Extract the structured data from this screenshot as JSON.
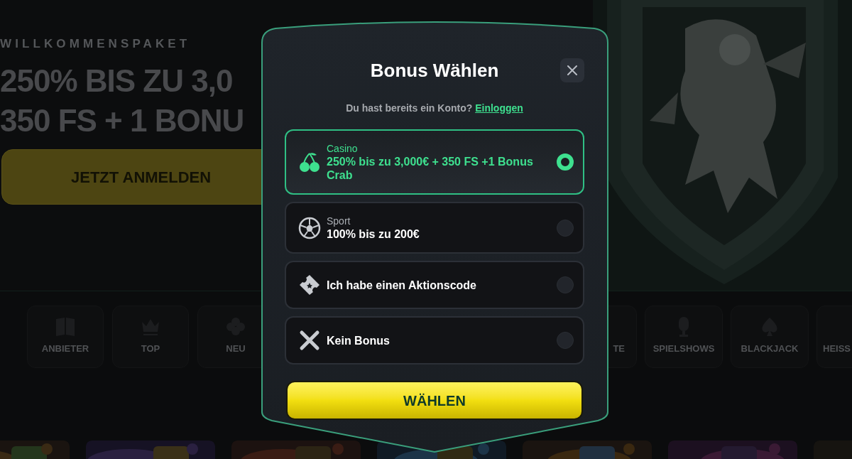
{
  "hero": {
    "eyebrow": "WILLKOMMENSPAKET",
    "headline_lines": [
      "250% BIS ZU 3,0",
      "350 FS + 1 BONU"
    ],
    "cta": "JETZT ANMELDEN"
  },
  "categories_left": [
    {
      "kind": "book",
      "label": "ANBIETER"
    },
    {
      "kind": "crown",
      "label": "TOP"
    },
    {
      "kind": "clover",
      "label": "NEU"
    }
  ],
  "categories_right": [
    {
      "kind": "hidden",
      "label": "TE"
    },
    {
      "kind": "microphone",
      "label": "SPIELSHOWS"
    },
    {
      "kind": "spade",
      "label": "BLACKJACK"
    },
    {
      "kind": "hidden",
      "label": "HEISS"
    }
  ],
  "modal": {
    "title": "Bonus Wählen",
    "login_prompt": "Du hast bereits ein Konto?",
    "login_link": "Einloggen",
    "options": [
      {
        "kind": "casino",
        "category": "Casino",
        "text": "250% bis zu 3,000€ + 350 FS +1 Bonus Crab",
        "selected": true
      },
      {
        "kind": "sport",
        "category": "Sport",
        "text": "100% bis zu 200€",
        "selected": false
      },
      {
        "kind": "promo_code",
        "text": "Ich habe einen Aktionscode",
        "selected": false
      },
      {
        "kind": "no_bonus",
        "text": "Kein Bonus",
        "selected": false
      }
    ],
    "submit": "WÄHLEN"
  }
}
